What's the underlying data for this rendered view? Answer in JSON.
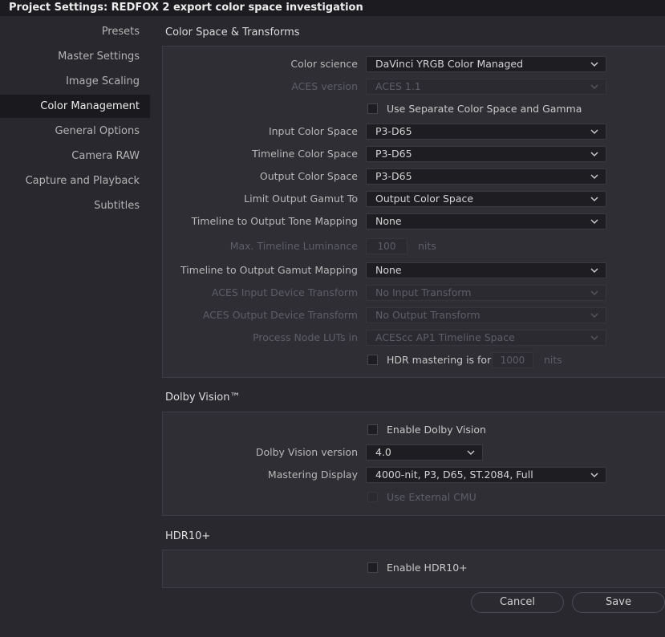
{
  "window": {
    "title": "Project Settings:  REDFOX 2 export color space investigation"
  },
  "sidebar": {
    "items": [
      {
        "label": "Presets"
      },
      {
        "label": "Master Settings"
      },
      {
        "label": "Image Scaling"
      },
      {
        "label": "Color Management",
        "active": true
      },
      {
        "label": "General Options"
      },
      {
        "label": "Camera RAW"
      },
      {
        "label": "Capture and Playback"
      },
      {
        "label": "Subtitles"
      }
    ]
  },
  "color_space": {
    "title": "Color Space & Transforms",
    "color_science": {
      "label": "Color science",
      "value": "DaVinci YRGB Color Managed"
    },
    "aces_version": {
      "label": "ACES version",
      "value": "ACES 1.1"
    },
    "separate_gamma": {
      "label": "Use Separate Color Space and Gamma"
    },
    "input_cs": {
      "label": "Input Color Space",
      "value": "P3-D65"
    },
    "timeline_cs": {
      "label": "Timeline Color Space",
      "value": "P3-D65"
    },
    "output_cs": {
      "label": "Output Color Space",
      "value": "P3-D65"
    },
    "limit_gamut": {
      "label": "Limit Output Gamut To",
      "value": "Output Color Space"
    },
    "tone_mapping": {
      "label": "Timeline to Output Tone Mapping",
      "value": "None"
    },
    "max_luminance": {
      "label": "Max. Timeline Luminance",
      "value": "100",
      "unit": "nits"
    },
    "gamut_mapping": {
      "label": "Timeline to Output Gamut Mapping",
      "value": "None"
    },
    "aces_idt": {
      "label": "ACES Input Device Transform",
      "value": "No Input Transform"
    },
    "aces_odt": {
      "label": "ACES Output Device Transform",
      "value": "No Output Transform"
    },
    "process_luts": {
      "label": "Process Node LUTs in",
      "value": "ACEScc AP1 Timeline Space"
    },
    "hdr_mastering": {
      "label": "HDR mastering is for",
      "value": "1000",
      "unit": "nits"
    }
  },
  "dolby": {
    "title": "Dolby Vision™",
    "enable": {
      "label": "Enable Dolby Vision"
    },
    "version": {
      "label": "Dolby Vision version",
      "value": "4.0"
    },
    "mastering": {
      "label": "Mastering Display",
      "value": "4000-nit, P3, D65, ST.2084, Full"
    },
    "external_cmu": {
      "label": "Use External CMU"
    }
  },
  "hdr10": {
    "title": "HDR10+",
    "enable": {
      "label": "Enable HDR10+"
    }
  },
  "buttons": {
    "cancel": "Cancel",
    "save": "Save"
  },
  "colors": {
    "background": "#28282e",
    "panel": "#2e2e34",
    "field": "#1e1e22",
    "titlebar": "#1c1c20"
  }
}
